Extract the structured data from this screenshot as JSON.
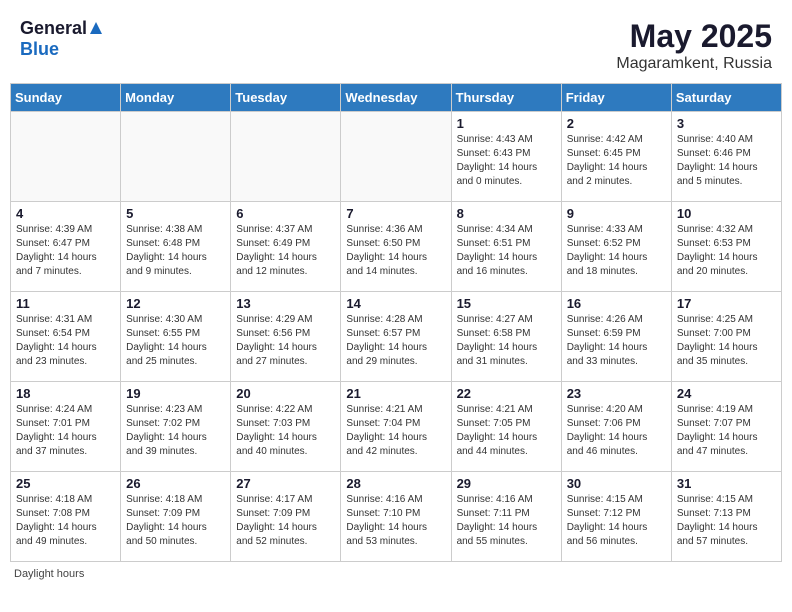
{
  "header": {
    "logo_general": "General",
    "logo_blue": "Blue",
    "title": "May 2025",
    "location": "Magaramkent, Russia"
  },
  "calendar": {
    "days_of_week": [
      "Sunday",
      "Monday",
      "Tuesday",
      "Wednesday",
      "Thursday",
      "Friday",
      "Saturday"
    ],
    "weeks": [
      [
        {
          "day": "",
          "info": ""
        },
        {
          "day": "",
          "info": ""
        },
        {
          "day": "",
          "info": ""
        },
        {
          "day": "",
          "info": ""
        },
        {
          "day": "1",
          "info": "Sunrise: 4:43 AM\nSunset: 6:43 PM\nDaylight: 14 hours\nand 0 minutes."
        },
        {
          "day": "2",
          "info": "Sunrise: 4:42 AM\nSunset: 6:45 PM\nDaylight: 14 hours\nand 2 minutes."
        },
        {
          "day": "3",
          "info": "Sunrise: 4:40 AM\nSunset: 6:46 PM\nDaylight: 14 hours\nand 5 minutes."
        }
      ],
      [
        {
          "day": "4",
          "info": "Sunrise: 4:39 AM\nSunset: 6:47 PM\nDaylight: 14 hours\nand 7 minutes."
        },
        {
          "day": "5",
          "info": "Sunrise: 4:38 AM\nSunset: 6:48 PM\nDaylight: 14 hours\nand 9 minutes."
        },
        {
          "day": "6",
          "info": "Sunrise: 4:37 AM\nSunset: 6:49 PM\nDaylight: 14 hours\nand 12 minutes."
        },
        {
          "day": "7",
          "info": "Sunrise: 4:36 AM\nSunset: 6:50 PM\nDaylight: 14 hours\nand 14 minutes."
        },
        {
          "day": "8",
          "info": "Sunrise: 4:34 AM\nSunset: 6:51 PM\nDaylight: 14 hours\nand 16 minutes."
        },
        {
          "day": "9",
          "info": "Sunrise: 4:33 AM\nSunset: 6:52 PM\nDaylight: 14 hours\nand 18 minutes."
        },
        {
          "day": "10",
          "info": "Sunrise: 4:32 AM\nSunset: 6:53 PM\nDaylight: 14 hours\nand 20 minutes."
        }
      ],
      [
        {
          "day": "11",
          "info": "Sunrise: 4:31 AM\nSunset: 6:54 PM\nDaylight: 14 hours\nand 23 minutes."
        },
        {
          "day": "12",
          "info": "Sunrise: 4:30 AM\nSunset: 6:55 PM\nDaylight: 14 hours\nand 25 minutes."
        },
        {
          "day": "13",
          "info": "Sunrise: 4:29 AM\nSunset: 6:56 PM\nDaylight: 14 hours\nand 27 minutes."
        },
        {
          "day": "14",
          "info": "Sunrise: 4:28 AM\nSunset: 6:57 PM\nDaylight: 14 hours\nand 29 minutes."
        },
        {
          "day": "15",
          "info": "Sunrise: 4:27 AM\nSunset: 6:58 PM\nDaylight: 14 hours\nand 31 minutes."
        },
        {
          "day": "16",
          "info": "Sunrise: 4:26 AM\nSunset: 6:59 PM\nDaylight: 14 hours\nand 33 minutes."
        },
        {
          "day": "17",
          "info": "Sunrise: 4:25 AM\nSunset: 7:00 PM\nDaylight: 14 hours\nand 35 minutes."
        }
      ],
      [
        {
          "day": "18",
          "info": "Sunrise: 4:24 AM\nSunset: 7:01 PM\nDaylight: 14 hours\nand 37 minutes."
        },
        {
          "day": "19",
          "info": "Sunrise: 4:23 AM\nSunset: 7:02 PM\nDaylight: 14 hours\nand 39 minutes."
        },
        {
          "day": "20",
          "info": "Sunrise: 4:22 AM\nSunset: 7:03 PM\nDaylight: 14 hours\nand 40 minutes."
        },
        {
          "day": "21",
          "info": "Sunrise: 4:21 AM\nSunset: 7:04 PM\nDaylight: 14 hours\nand 42 minutes."
        },
        {
          "day": "22",
          "info": "Sunrise: 4:21 AM\nSunset: 7:05 PM\nDaylight: 14 hours\nand 44 minutes."
        },
        {
          "day": "23",
          "info": "Sunrise: 4:20 AM\nSunset: 7:06 PM\nDaylight: 14 hours\nand 46 minutes."
        },
        {
          "day": "24",
          "info": "Sunrise: 4:19 AM\nSunset: 7:07 PM\nDaylight: 14 hours\nand 47 minutes."
        }
      ],
      [
        {
          "day": "25",
          "info": "Sunrise: 4:18 AM\nSunset: 7:08 PM\nDaylight: 14 hours\nand 49 minutes."
        },
        {
          "day": "26",
          "info": "Sunrise: 4:18 AM\nSunset: 7:09 PM\nDaylight: 14 hours\nand 50 minutes."
        },
        {
          "day": "27",
          "info": "Sunrise: 4:17 AM\nSunset: 7:09 PM\nDaylight: 14 hours\nand 52 minutes."
        },
        {
          "day": "28",
          "info": "Sunrise: 4:16 AM\nSunset: 7:10 PM\nDaylight: 14 hours\nand 53 minutes."
        },
        {
          "day": "29",
          "info": "Sunrise: 4:16 AM\nSunset: 7:11 PM\nDaylight: 14 hours\nand 55 minutes."
        },
        {
          "day": "30",
          "info": "Sunrise: 4:15 AM\nSunset: 7:12 PM\nDaylight: 14 hours\nand 56 minutes."
        },
        {
          "day": "31",
          "info": "Sunrise: 4:15 AM\nSunset: 7:13 PM\nDaylight: 14 hours\nand 57 minutes."
        }
      ]
    ]
  },
  "footer": {
    "note": "Daylight hours"
  }
}
